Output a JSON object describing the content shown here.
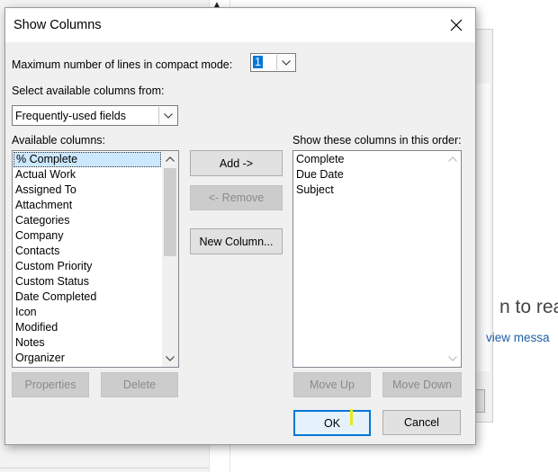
{
  "background": {
    "reading_text": "n to reac",
    "preview_text": "view messa",
    "scroll_arrow": "▲"
  },
  "dialog": {
    "title": "Show Columns",
    "close_icon": "close-icon",
    "compact_label": "Maximum number of lines in compact mode:",
    "compact_value": "1",
    "select_from_label": "Select available columns from:",
    "select_from_value": "Frequently-used fields",
    "available_label": "Available columns:",
    "available_items": [
      "% Complete",
      "Actual Work",
      "Assigned To",
      "Attachment",
      "Categories",
      "Company",
      "Contacts",
      "Custom Priority",
      "Custom Status",
      "Date Completed",
      "Icon",
      "Modified",
      "Notes",
      "Organizer"
    ],
    "selected_index": 0,
    "show_label": "Show these columns in this order:",
    "show_items": [
      "Complete",
      "Due Date",
      "Subject"
    ],
    "add_button": "Add ->",
    "remove_button": "<- Remove",
    "new_column_button": "New Column...",
    "properties_button": "Properties",
    "delete_button": "Delete",
    "move_up_button": "Move Up",
    "move_down_button": "Move Down",
    "ok_button": "OK",
    "cancel_button": "Cancel"
  },
  "colors": {
    "selection_bg": "#cce8ff",
    "accent": "#0078d7",
    "link": "#1f5ea8",
    "dialog_bg": "#f0f0f0"
  }
}
